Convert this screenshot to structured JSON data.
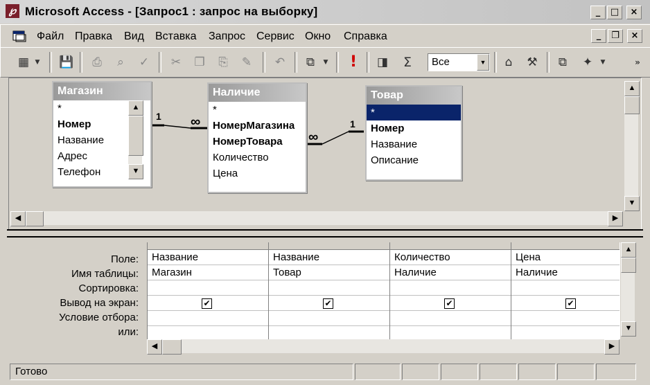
{
  "window": {
    "title": "Microsoft Access - [Запрос1 : запрос на выборку]",
    "app_icon": "access-icon",
    "controls": [
      "_",
      "□",
      "×"
    ]
  },
  "menu": [
    "Файл",
    "Правка",
    "Вид",
    "Вставка",
    "Запрос",
    "Сервис",
    "Окно",
    "Справка"
  ],
  "toolbar": {
    "query_type_value": "Все",
    "icons": [
      "view-icon",
      "save-icon",
      "print-icon",
      "preview-icon",
      "spell-icon",
      "cut-icon",
      "copy-icon",
      "paste-icon",
      "format-painter-icon",
      "undo-icon",
      "query-type-icon",
      "run-icon",
      "show-table-icon",
      "totals-icon",
      "properties-icon",
      "build-icon",
      "database-window-icon",
      "new-object-icon",
      "more-icon"
    ],
    "run_symbol": "!",
    "totals_symbol": "Σ"
  },
  "tables": [
    {
      "name": "Магазин",
      "fields": [
        {
          "label": "*",
          "key": false
        },
        {
          "label": "Номер",
          "key": true
        },
        {
          "label": "Название",
          "key": false
        },
        {
          "label": "Адрес",
          "key": false
        },
        {
          "label": "Телефон",
          "key": false
        }
      ]
    },
    {
      "name": "Наличие",
      "fields": [
        {
          "label": "*",
          "key": false
        },
        {
          "label": "НомерМагазина",
          "key": true
        },
        {
          "label": "НомерТовара",
          "key": true
        },
        {
          "label": "Количество",
          "key": false
        },
        {
          "label": "Цена",
          "key": false
        }
      ]
    },
    {
      "name": "Товар",
      "fields": [
        {
          "label": "*",
          "key": false
        },
        {
          "label": "Номер",
          "key": true
        },
        {
          "label": "Название",
          "key": false
        },
        {
          "label": "Описание",
          "key": false
        }
      ]
    }
  ],
  "relations": [
    {
      "one": "1",
      "many": "∞"
    },
    {
      "one": "1",
      "many": "∞"
    }
  ],
  "grid": {
    "row_labels": [
      "Поле:",
      "Имя таблицы:",
      "Сортировка:",
      "Вывод на экран:",
      "Условие отбора:",
      "или:"
    ],
    "columns": [
      {
        "field": "Название",
        "table": "Магазин",
        "sort": "",
        "show": true
      },
      {
        "field": "Название",
        "table": "Товар",
        "sort": "",
        "show": true
      },
      {
        "field": "Количество",
        "table": "Наличие",
        "sort": "",
        "show": true
      },
      {
        "field": "Цена",
        "table": "Наличие",
        "sort": "",
        "show": true
      }
    ]
  },
  "status": {
    "text": "Готово"
  }
}
